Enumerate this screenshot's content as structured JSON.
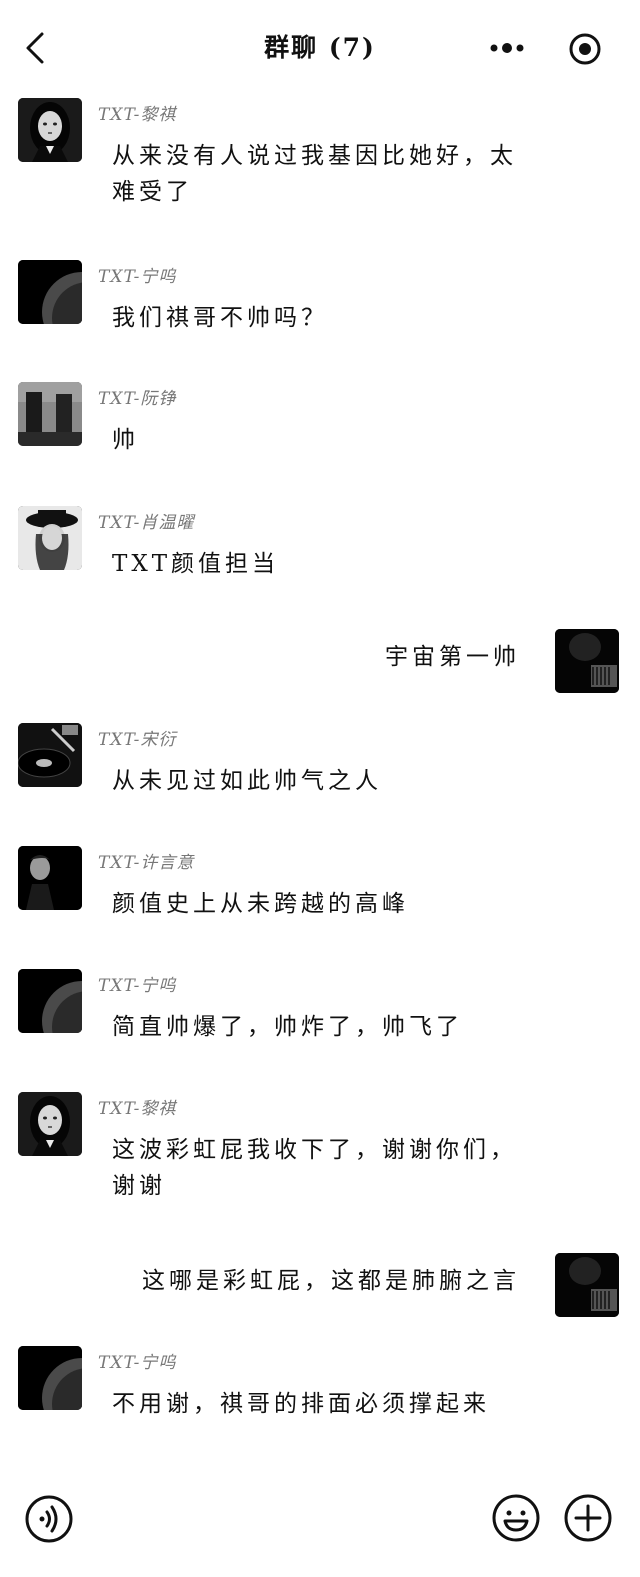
{
  "header": {
    "title": "群聊 (7)",
    "back_icon": "chevron-left-icon",
    "more_icon": "more-dots-icon",
    "target_icon": "target-icon"
  },
  "messages": [
    {
      "direction": "in",
      "sender": "TXT-黎祺",
      "text": "从来没有人说过我基因比她好，太难受了",
      "avatar": "girl-portrait"
    },
    {
      "direction": "in",
      "sender": "TXT-宁呜",
      "text": "我们祺哥不帅吗？",
      "avatar": "moon"
    },
    {
      "direction": "in",
      "sender": "TXT-阮铮",
      "text": "帅",
      "avatar": "city-towers"
    },
    {
      "direction": "in",
      "sender": "TXT-肖温曜",
      "text": "TXT颜值担当",
      "avatar": "hat-girl"
    },
    {
      "direction": "out",
      "text": "宇宙第一帅",
      "avatar": "dark-piano"
    },
    {
      "direction": "in",
      "sender": "TXT-宋衍",
      "text": "从未见过如此帅气之人",
      "avatar": "vinyl-record"
    },
    {
      "direction": "in",
      "sender": "TXT-许言意",
      "text": "颜值史上从未跨越的高峰",
      "avatar": "man-portrait"
    },
    {
      "direction": "in",
      "sender": "TXT-宁呜",
      "text": "简直帅爆了，帅炸了，帅飞了",
      "avatar": "moon"
    },
    {
      "direction": "in",
      "sender": "TXT-黎祺",
      "text": "这波彩虹屁我收下了，谢谢你们，谢谢",
      "avatar": "girl-portrait"
    },
    {
      "direction": "out",
      "text": "这哪是彩虹屁，这都是肺腑之言",
      "avatar": "dark-piano"
    },
    {
      "direction": "in",
      "sender": "TXT-宁呜",
      "text": "不用谢，祺哥的排面必须撑起来",
      "avatar": "moon"
    }
  ],
  "footer": {
    "voice_icon": "voice-icon",
    "emoji_icon": "emoji-icon",
    "plus_icon": "plus-icon"
  }
}
